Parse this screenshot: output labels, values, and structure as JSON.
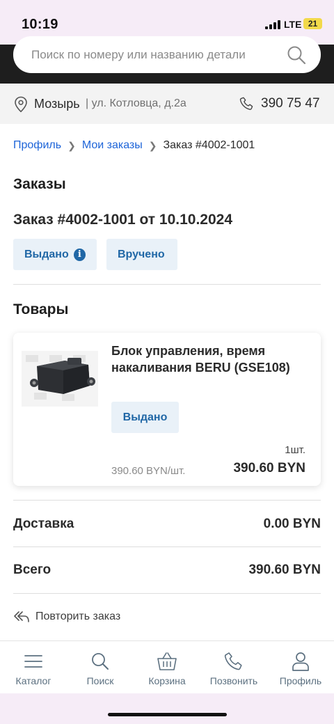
{
  "status_bar": {
    "time": "10:19",
    "network": "LTE",
    "battery": "21",
    "battery_color": "#f2d94a"
  },
  "search": {
    "placeholder": "Поиск по номеру или названию детали",
    "icon": "search-icon"
  },
  "location": {
    "city": "Мозырь",
    "address": "| ул. Котловца, д.2а",
    "phone": "390 75 47"
  },
  "breadcrumb": {
    "items": [
      "Профиль",
      "Мои заказы"
    ],
    "current": "Заказ #4002-1001"
  },
  "page_title": "Заказы",
  "order": {
    "title": "Заказ #4002-1001 от 10.10.2024",
    "statuses": [
      "Выдано",
      "Вручено"
    ],
    "info_glyph": "i"
  },
  "products_heading": "Товары",
  "product": {
    "name": "Блок управления, время накаливания BERU (GSE108)",
    "status": "Выдано",
    "quantity": "1шт.",
    "unit_price": "390.60 BYN/шт.",
    "total": "390.60 BYN"
  },
  "summary": {
    "delivery_label": "Доставка",
    "delivery_value": "0.00 BYN",
    "total_label": "Всего",
    "total_value": "390.60 BYN"
  },
  "repeat_order": "Повторить заказ",
  "nav": {
    "items": [
      {
        "label": "Каталог",
        "icon": "menu-icon"
      },
      {
        "label": "Поиск",
        "icon": "search-icon"
      },
      {
        "label": "Корзина",
        "icon": "basket-icon"
      },
      {
        "label": "Позвонить",
        "icon": "phone-icon"
      },
      {
        "label": "Профиль",
        "icon": "user-icon"
      }
    ]
  },
  "colors": {
    "accent": "#2067a6",
    "link": "#1d64d8",
    "chip_bg": "#e9f1f8",
    "header_bg": "#1e1e1e"
  }
}
